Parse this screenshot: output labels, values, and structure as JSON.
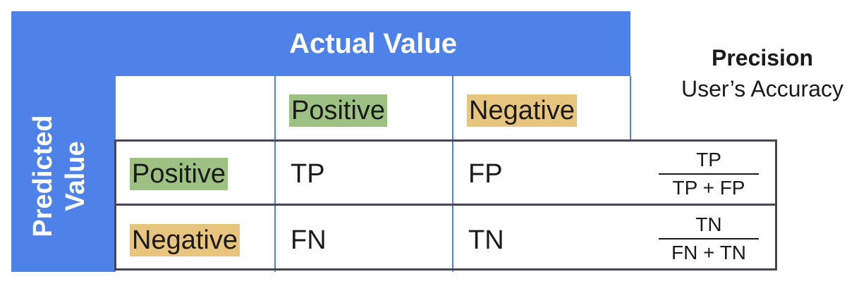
{
  "colors": {
    "header_blue": "#4e82e8",
    "positive_green": "#9dc183",
    "negative_orange": "#e8c57e",
    "box_border": "#4a4358"
  },
  "header": {
    "title": "Actual Value"
  },
  "row_header": {
    "line1": "Predicted",
    "line2": "Value"
  },
  "columns": {
    "positive": "Positive",
    "negative": "Negative"
  },
  "rows": {
    "positive": {
      "label": "Positive",
      "cells": [
        "TP",
        "FP"
      ]
    },
    "negative": {
      "label": "Negative",
      "cells": [
        "FN",
        "TN"
      ]
    }
  },
  "precision": {
    "title": "Precision",
    "subtitle": "User’s Accuracy",
    "positive": {
      "numerator": "TP",
      "denominator": "TP + FP"
    },
    "negative": {
      "numerator": "TN",
      "denominator": "FN + TN"
    }
  }
}
